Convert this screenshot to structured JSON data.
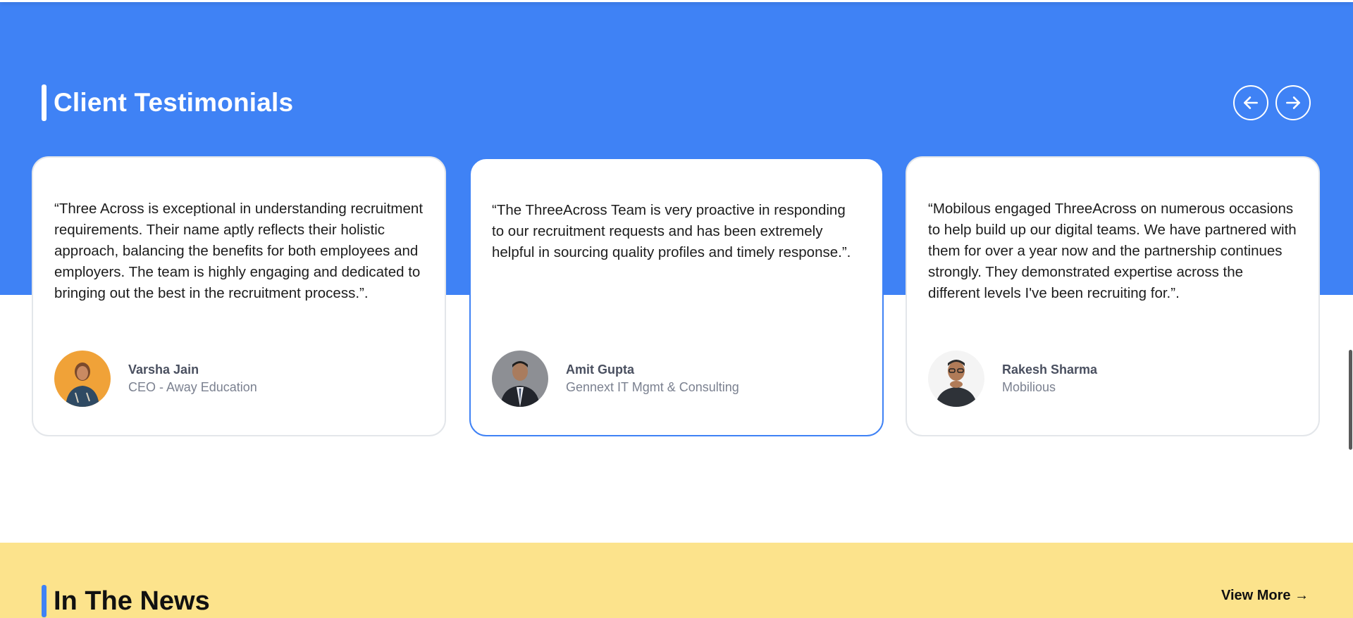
{
  "testimonials": {
    "title": "Client Testimonials",
    "nav": {
      "prev_icon": "arrow-left-icon",
      "next_icon": "arrow-right-icon"
    },
    "cards": [
      {
        "quote": "“Three Across is exceptional in understanding recruitment requirements. Their name aptly reflects their holistic approach, balancing the benefits for both employees and employers. The team is highly engaging and dedicated to bringing out the best in the recruitment process.”.",
        "name": "Varsha Jain",
        "role": "CEO - Away Education"
      },
      {
        "quote": "“The ThreeAcross Team is very proactive in responding to our recruitment requests and has been extremely helpful in sourcing quality profiles and timely response.”.",
        "name": "Amit Gupta",
        "role": "Gennext IT Mgmt & Consulting"
      },
      {
        "quote": "“Mobilous engaged ThreeAcross on numerous occasions to help build up our digital teams. We have partnered with them for over a year now and the partnership continues strongly. They demonstrated expertise across the different levels I've been recruiting for.”.",
        "name": "Rakesh Sharma",
        "role": "Mobilious"
      }
    ]
  },
  "news": {
    "title": "In The News",
    "view_more": "View More →"
  },
  "colors": {
    "brand_blue": "#3f82f5",
    "news_yellow": "#fce38c"
  }
}
